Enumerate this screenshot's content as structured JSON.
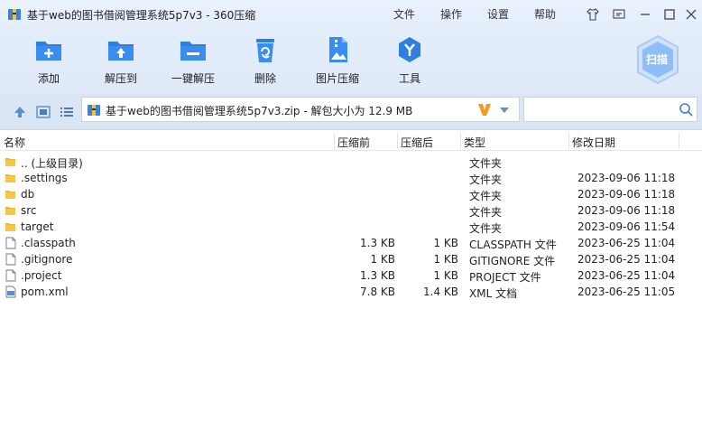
{
  "window": {
    "title": "基于web的图书借阅管理系统5p7v3 - 360压缩",
    "menu": [
      "文件",
      "操作",
      "设置",
      "帮助"
    ]
  },
  "toolbar": {
    "buttons": [
      {
        "label": "添加",
        "icon": "add-icon"
      },
      {
        "label": "解压到",
        "icon": "extract-to-icon"
      },
      {
        "label": "一键解压",
        "icon": "one-click-extract-icon"
      },
      {
        "label": "删除",
        "icon": "delete-icon"
      },
      {
        "label": "图片压缩",
        "icon": "image-compress-icon"
      },
      {
        "label": "工具",
        "icon": "tools-icon"
      }
    ],
    "scan_label": "扫描"
  },
  "address": {
    "path": "基于web的图书借阅管理系统5p7v3.zip - 解包大小为 12.9 MB",
    "search_value": ""
  },
  "columns": {
    "name": "名称",
    "compressed": "压缩前",
    "uncompressed": "压缩后",
    "type": "类型",
    "modified": "修改日期"
  },
  "files": [
    {
      "name": ".. (上级目录)",
      "csize": "",
      "usize": "",
      "type": "文件夹",
      "date": "",
      "kind": "folder"
    },
    {
      "name": ".settings",
      "csize": "",
      "usize": "",
      "type": "文件夹",
      "date": "2023-09-06 11:18",
      "kind": "folder"
    },
    {
      "name": "db",
      "csize": "",
      "usize": "",
      "type": "文件夹",
      "date": "2023-09-06 11:18",
      "kind": "folder"
    },
    {
      "name": "src",
      "csize": "",
      "usize": "",
      "type": "文件夹",
      "date": "2023-09-06 11:18",
      "kind": "folder"
    },
    {
      "name": "target",
      "csize": "",
      "usize": "",
      "type": "文件夹",
      "date": "2023-09-06 11:54",
      "kind": "folder"
    },
    {
      "name": ".classpath",
      "csize": "1.3 KB",
      "usize": "1 KB",
      "type": "CLASSPATH 文件",
      "date": "2023-06-25 11:04",
      "kind": "file"
    },
    {
      "name": ".gitignore",
      "csize": "1 KB",
      "usize": "1 KB",
      "type": "GITIGNORE 文件",
      "date": "2023-06-25 11:04",
      "kind": "file"
    },
    {
      "name": ".project",
      "csize": "1.3 KB",
      "usize": "1 KB",
      "type": "PROJECT 文件",
      "date": "2023-06-25 11:04",
      "kind": "file"
    },
    {
      "name": "pom.xml",
      "csize": "7.8 KB",
      "usize": "1.4 KB",
      "type": "XML 文档",
      "date": "2023-06-25 11:05",
      "kind": "xml"
    }
  ]
}
